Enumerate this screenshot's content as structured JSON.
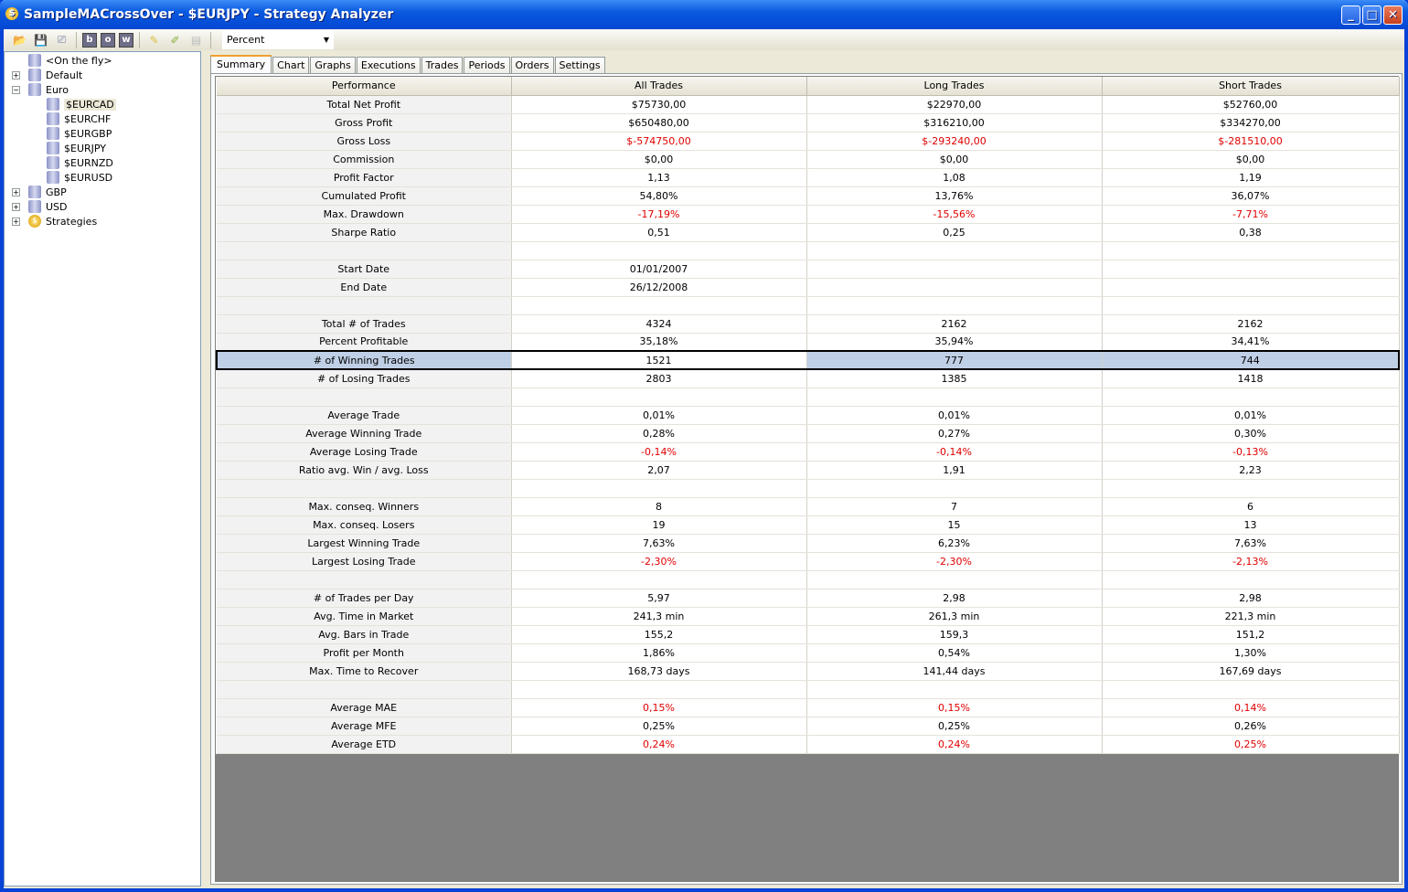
{
  "window": {
    "title": "SampleMACrossOver - $EURJPY - Strategy Analyzer",
    "minimize": "_",
    "maximize": "□",
    "close": "✕"
  },
  "toolbar": {
    "display_mode": "Percent",
    "buttons": [
      "open-icon",
      "save-icon",
      "presentation-icon",
      "b",
      "o",
      "w",
      "notes-icon",
      "edit-notes-icon",
      "disabled-icon"
    ]
  },
  "tree": [
    {
      "label": "<On the fly>",
      "level": 0,
      "icon": "database-icon",
      "expander": ""
    },
    {
      "label": "Default",
      "level": 0,
      "icon": "database-group-icon",
      "expander": "+"
    },
    {
      "label": "Euro",
      "level": 0,
      "icon": "database-group-icon",
      "expander": "−"
    },
    {
      "label": "$EURCAD",
      "level": 1,
      "icon": "database-icon",
      "expander": "",
      "selected": true
    },
    {
      "label": "$EURCHF",
      "level": 1,
      "icon": "database-icon",
      "expander": ""
    },
    {
      "label": "$EURGBP",
      "level": 1,
      "icon": "database-icon",
      "expander": ""
    },
    {
      "label": "$EURJPY",
      "level": 1,
      "icon": "database-icon",
      "expander": ""
    },
    {
      "label": "$EURNZD",
      "level": 1,
      "icon": "database-icon",
      "expander": ""
    },
    {
      "label": "$EURUSD",
      "level": 1,
      "icon": "database-icon",
      "expander": ""
    },
    {
      "label": "GBP",
      "level": 0,
      "icon": "database-group-icon",
      "expander": "+"
    },
    {
      "label": "USD",
      "level": 0,
      "icon": "database-group-icon",
      "expander": "+"
    },
    {
      "label": "Strategies",
      "level": 0,
      "icon": "strategy-coin-icon",
      "expander": "+"
    }
  ],
  "tabs": [
    "Summary",
    "Chart",
    "Graphs",
    "Executions",
    "Trades",
    "Periods",
    "Orders",
    "Settings"
  ],
  "active_tab": "Summary",
  "colors": {
    "negative": "#e00000",
    "selected_row": "#bfcfe6"
  },
  "table": {
    "headers": [
      "Performance",
      "All Trades",
      "Long Trades",
      "Short Trades"
    ],
    "selected_row": 14,
    "rows": [
      [
        "Total Net Profit",
        "$75730,00",
        "$22970,00",
        "$52760,00"
      ],
      [
        "Gross Profit",
        "$650480,00",
        "$316210,00",
        "$334270,00"
      ],
      [
        "Gross Loss",
        "$-574750,00",
        "$-293240,00",
        "$-281510,00"
      ],
      [
        "Commission",
        "$0,00",
        "$0,00",
        "$0,00"
      ],
      [
        "Profit Factor",
        "1,13",
        "1,08",
        "1,19"
      ],
      [
        "Cumulated Profit",
        "54,80%",
        "13,76%",
        "36,07%"
      ],
      [
        "Max. Drawdown",
        "-17,19%",
        "-15,56%",
        "-7,71%"
      ],
      [
        "Sharpe Ratio",
        "0,51",
        "0,25",
        "0,38"
      ],
      [
        "",
        "",
        "",
        ""
      ],
      [
        "Start Date",
        "01/01/2007",
        "",
        ""
      ],
      [
        "End Date",
        "26/12/2008",
        "",
        ""
      ],
      [
        "",
        "",
        "",
        ""
      ],
      [
        "Total # of Trades",
        "4324",
        "2162",
        "2162"
      ],
      [
        "Percent Profitable",
        "35,18%",
        "35,94%",
        "34,41%"
      ],
      [
        "# of Winning Trades",
        "1521",
        "777",
        "744"
      ],
      [
        "# of Losing Trades",
        "2803",
        "1385",
        "1418"
      ],
      [
        "",
        "",
        "",
        ""
      ],
      [
        "Average Trade",
        "0,01%",
        "0,01%",
        "0,01%"
      ],
      [
        "Average Winning Trade",
        "0,28%",
        "0,27%",
        "0,30%"
      ],
      [
        "Average Losing Trade",
        "-0,14%",
        "-0,14%",
        "-0,13%"
      ],
      [
        "Ratio avg. Win / avg. Loss",
        "2,07",
        "1,91",
        "2,23"
      ],
      [
        "",
        "",
        "",
        ""
      ],
      [
        "Max. conseq. Winners",
        "8",
        "7",
        "6"
      ],
      [
        "Max. conseq. Losers",
        "19",
        "15",
        "13"
      ],
      [
        "Largest Winning Trade",
        "7,63%",
        "6,23%",
        "7,63%"
      ],
      [
        "Largest Losing Trade",
        "-2,30%",
        "-2,30%",
        "-2,13%"
      ],
      [
        "",
        "",
        "",
        ""
      ],
      [
        "# of Trades per Day",
        "5,97",
        "2,98",
        "2,98"
      ],
      [
        "Avg. Time in Market",
        "241,3 min",
        "261,3 min",
        "221,3 min"
      ],
      [
        "Avg. Bars in Trade",
        "155,2",
        "159,3",
        "151,2"
      ],
      [
        "Profit per Month",
        "1,86%",
        "0,54%",
        "1,30%"
      ],
      [
        "Max. Time to Recover",
        "168,73 days",
        "141,44 days",
        "167,69 days"
      ],
      [
        "",
        "",
        "",
        ""
      ],
      [
        "Average MAE",
        "0,15%",
        "0,15%",
        "0,14%"
      ],
      [
        "Average MFE",
        "0,25%",
        "0,25%",
        "0,26%"
      ],
      [
        "Average ETD",
        "0,24%",
        "0,24%",
        "0,25%"
      ]
    ],
    "negative_cells": [
      [
        33,
        1
      ],
      [
        33,
        2
      ],
      [
        33,
        3
      ],
      [
        35,
        1
      ],
      [
        35,
        2
      ],
      [
        35,
        3
      ]
    ]
  }
}
